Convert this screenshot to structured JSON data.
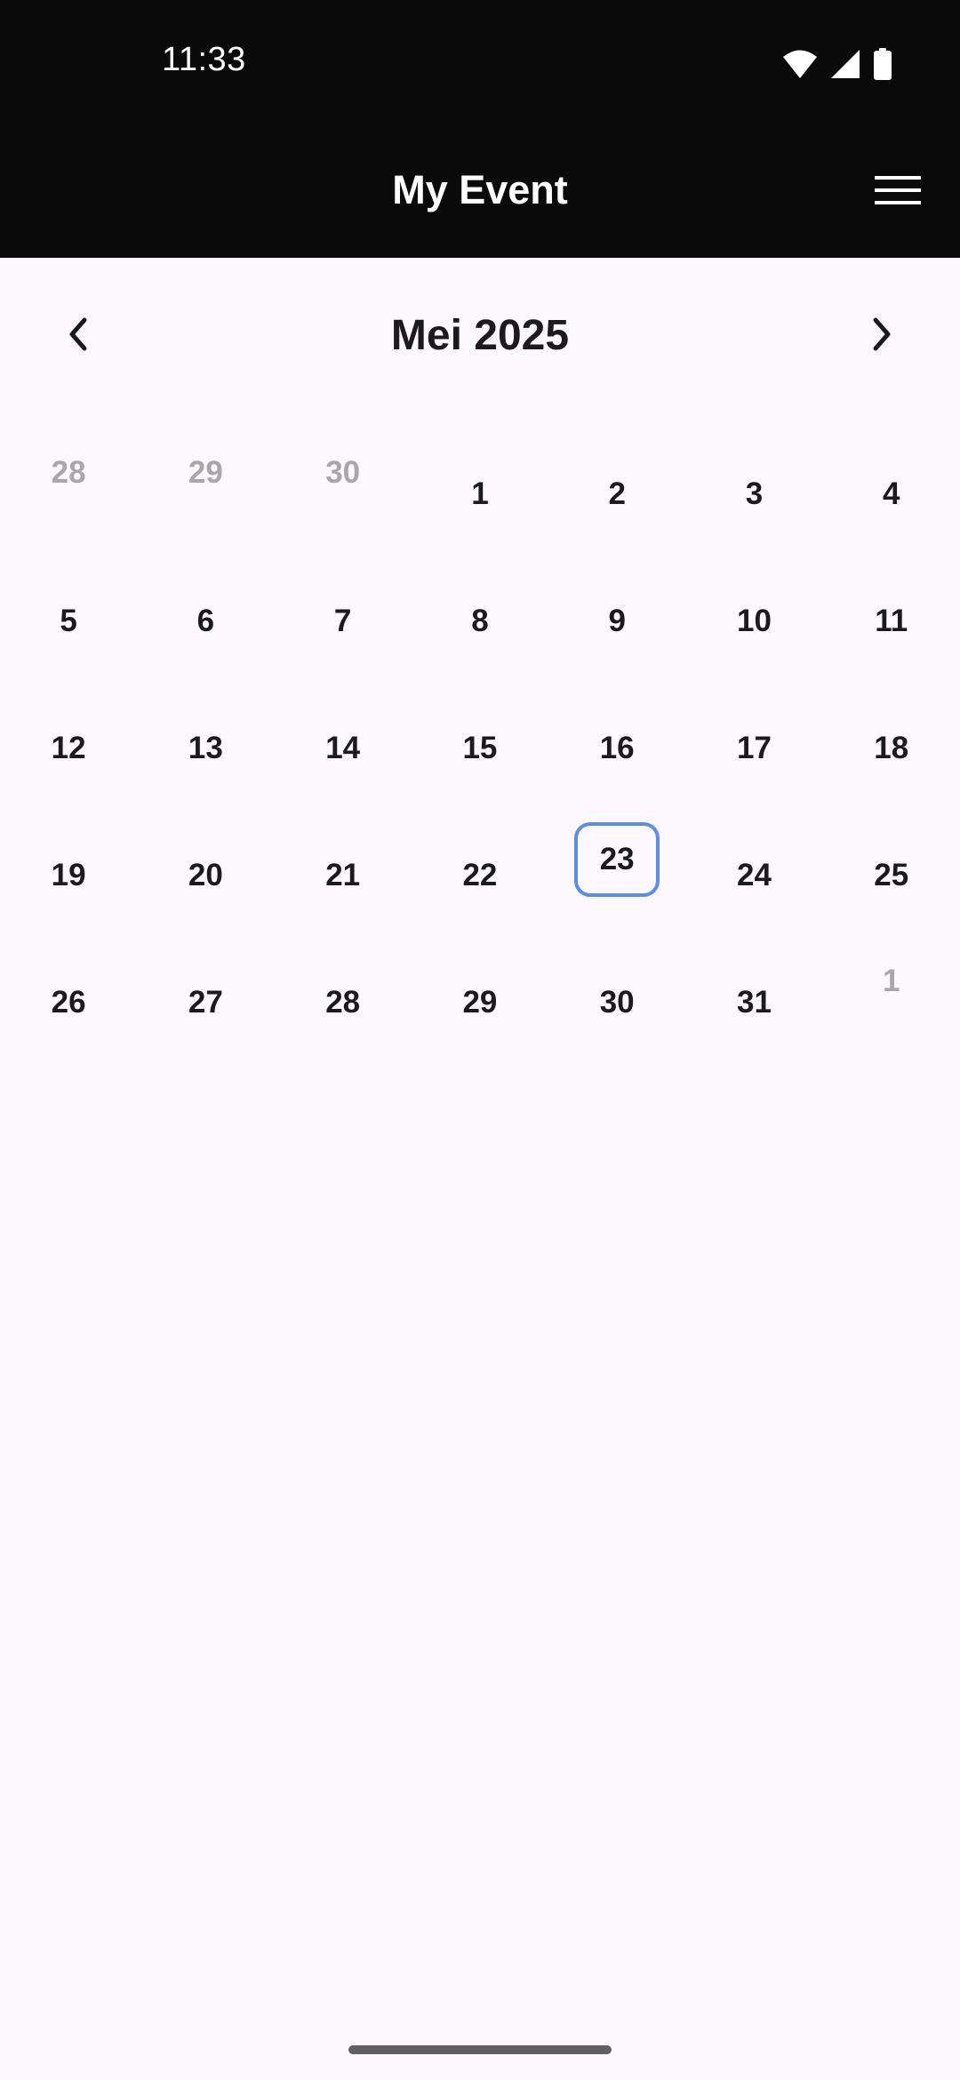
{
  "status_bar": {
    "time": "11:33",
    "icons": [
      "wifi-icon",
      "cell-signal-icon",
      "battery-icon"
    ]
  },
  "app_bar": {
    "title": "My Event",
    "menu_icon": "hamburger-menu-icon"
  },
  "calendar": {
    "month_label": "Mei 2025",
    "prev_icon": "chevron-left-icon",
    "next_icon": "chevron-right-icon",
    "selected_day": "23",
    "weeks": [
      [
        {
          "d": "28",
          "o": true
        },
        {
          "d": "29",
          "o": true
        },
        {
          "d": "30",
          "o": true
        },
        {
          "d": "1"
        },
        {
          "d": "2"
        },
        {
          "d": "3"
        },
        {
          "d": "4"
        }
      ],
      [
        {
          "d": "5"
        },
        {
          "d": "6"
        },
        {
          "d": "7"
        },
        {
          "d": "8"
        },
        {
          "d": "9"
        },
        {
          "d": "10"
        },
        {
          "d": "11"
        }
      ],
      [
        {
          "d": "12"
        },
        {
          "d": "13"
        },
        {
          "d": "14"
        },
        {
          "d": "15"
        },
        {
          "d": "16"
        },
        {
          "d": "17"
        },
        {
          "d": "18"
        }
      ],
      [
        {
          "d": "19"
        },
        {
          "d": "20"
        },
        {
          "d": "21"
        },
        {
          "d": "22"
        },
        {
          "d": "23",
          "s": true
        },
        {
          "d": "24"
        },
        {
          "d": "25"
        }
      ],
      [
        {
          "d": "26"
        },
        {
          "d": "27"
        },
        {
          "d": "28"
        },
        {
          "d": "29"
        },
        {
          "d": "30"
        },
        {
          "d": "31"
        },
        {
          "d": "1",
          "o": true
        }
      ]
    ]
  },
  "colors": {
    "background": "#FDF7FE",
    "header": "#0A0A0B",
    "selected_border": "#5B8DEF",
    "other_month_text": "#A8A8A8",
    "day_text": "#1B1B1F"
  }
}
